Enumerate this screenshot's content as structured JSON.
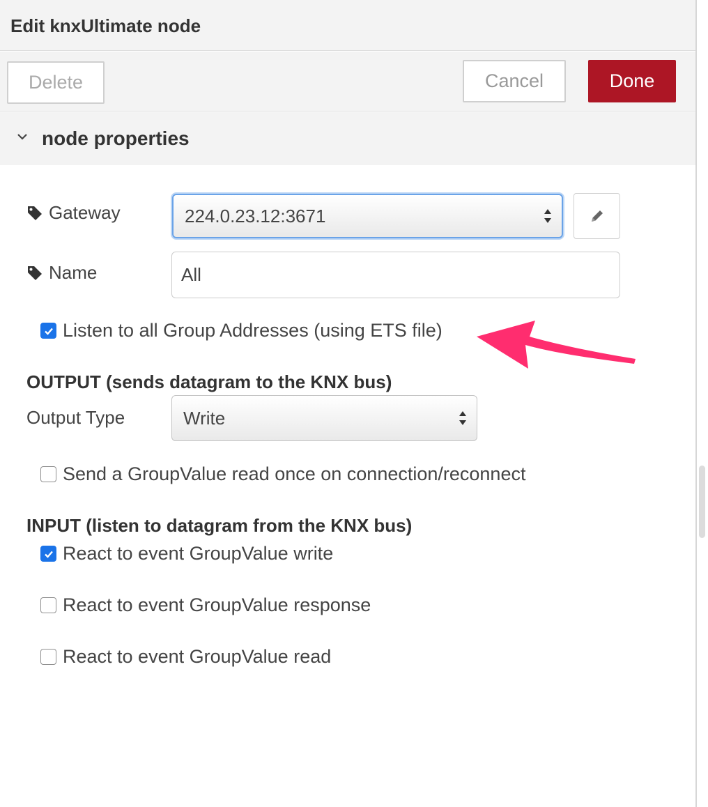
{
  "header": {
    "title": "Edit knxUltimate node"
  },
  "toolbar": {
    "delete_label": "Delete",
    "cancel_label": "Cancel",
    "done_label": "Done"
  },
  "section": {
    "title": "node properties"
  },
  "gateway": {
    "label": "Gateway",
    "value": "224.0.23.12:3671"
  },
  "name": {
    "label": "Name",
    "value": "All"
  },
  "listen_all": {
    "label": "Listen to all Group Addresses (using ETS file)",
    "checked": true
  },
  "output": {
    "heading": "OUTPUT (sends datagram to the KNX bus)",
    "type_label": "Output Type",
    "type_value": "Write",
    "read_on_connect": {
      "label": "Send a GroupValue read once on connection/reconnect",
      "checked": false
    }
  },
  "input": {
    "heading": "INPUT (listen to datagram from the KNX bus)",
    "react_write": {
      "label": "React to event GroupValue write",
      "checked": true
    },
    "react_response": {
      "label": "React to event GroupValue response",
      "checked": false
    },
    "react_read": {
      "label": "React to event GroupValue read",
      "checked": false
    }
  },
  "icons": {
    "collapse": "chevron-down-icon",
    "field": "tag-icon",
    "edit": "pencil-icon",
    "select": "select-arrows-icon",
    "annotation": "pink-arrow-icon"
  },
  "colors": {
    "done": "#ad1625",
    "checkbox": "#1a73e8",
    "focus": "#6aa3e8",
    "annotation": "#ff2d6f"
  }
}
